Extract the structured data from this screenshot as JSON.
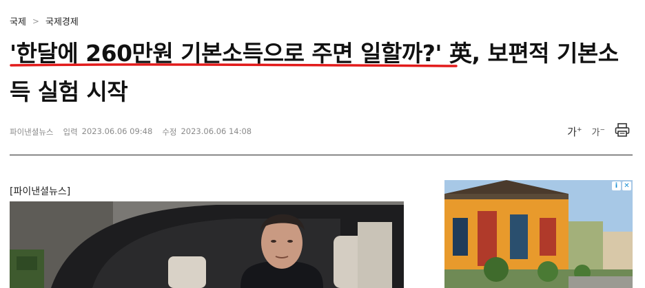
{
  "breadcrumb": {
    "section": "국제",
    "subsection": "국제경제"
  },
  "headline": {
    "quoted": "'한달에 260만원 기본소득으로 주면 일할까?'",
    "rest": " 英, 보편적 기본소득 실험 시작"
  },
  "meta": {
    "source": "파이낸셜뉴스",
    "published_label": "입력",
    "published": "2023.06.06 09:48",
    "updated_label": "수정",
    "updated": "2023.06.06 14:08"
  },
  "tools": {
    "font_up": "가",
    "font_down": "가",
    "print_icon": "print-icon"
  },
  "article": {
    "source_tag": "[파이낸셜뉴스]"
  },
  "ad": {
    "info_icon": "i",
    "close_icon": "✕"
  },
  "colors": {
    "accent": "#e21a1a"
  }
}
